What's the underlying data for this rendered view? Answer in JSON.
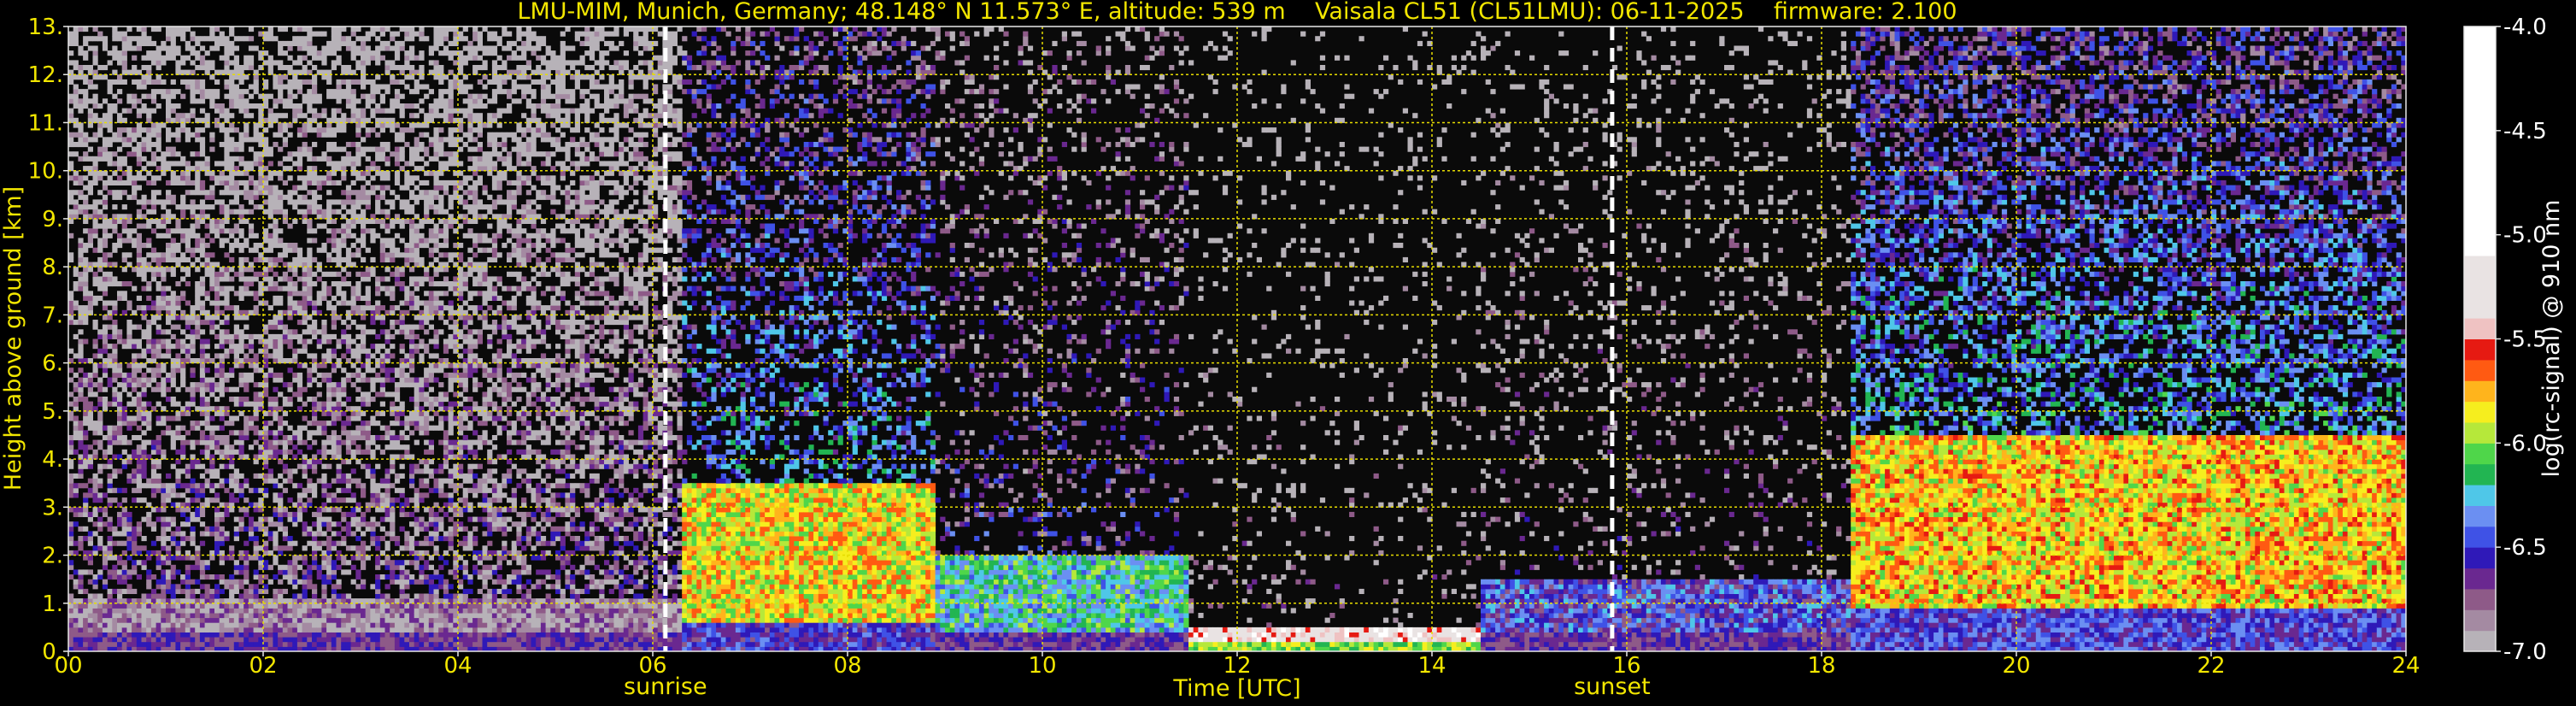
{
  "chart_data": {
    "type": "heatmap",
    "title": "LMU-MIM, Munich, Germany; 48.148° N 11.573° E, altitude: 539 m    Vaisala CL51 (CL51LMU): 06-11-2025    firmware: 2.100",
    "xlabel": "Time [UTC]",
    "ylabel": "Height above ground [km]",
    "colorbar_label": "log(rc-signal) @ 910 nm",
    "xlim": [
      0,
      24
    ],
    "ylim": [
      0,
      13
    ],
    "clim": [
      -7.0,
      -4.0
    ],
    "grid": true,
    "x_ticks": [
      {
        "value": 0,
        "label": "00"
      },
      {
        "value": 2,
        "label": "02"
      },
      {
        "value": 4,
        "label": "04"
      },
      {
        "value": 6,
        "label": "06"
      },
      {
        "value": 8,
        "label": "08"
      },
      {
        "value": 10,
        "label": "10"
      },
      {
        "value": 12,
        "label": "12"
      },
      {
        "value": 14,
        "label": "14"
      },
      {
        "value": 16,
        "label": "16"
      },
      {
        "value": 18,
        "label": "18"
      },
      {
        "value": 20,
        "label": "20"
      },
      {
        "value": 22,
        "label": "22"
      },
      {
        "value": 24,
        "label": "24"
      }
    ],
    "y_ticks": [
      {
        "value": 0,
        "label": "0."
      },
      {
        "value": 1,
        "label": "1."
      },
      {
        "value": 2,
        "label": "2."
      },
      {
        "value": 3,
        "label": "3."
      },
      {
        "value": 4,
        "label": "4."
      },
      {
        "value": 5,
        "label": "5."
      },
      {
        "value": 6,
        "label": "6."
      },
      {
        "value": 7,
        "label": "7."
      },
      {
        "value": 8,
        "label": "8."
      },
      {
        "value": 9,
        "label": "9."
      },
      {
        "value": 10,
        "label": "10."
      },
      {
        "value": 11,
        "label": "11."
      },
      {
        "value": 12,
        "label": "12."
      },
      {
        "value": 13,
        "label": "13."
      }
    ],
    "colorbar_ticks": [
      {
        "value": -4.0,
        "label": "-4.0"
      },
      {
        "value": -4.5,
        "label": "-4.5"
      },
      {
        "value": -5.0,
        "label": "-5.0"
      },
      {
        "value": -5.5,
        "label": "-5.5"
      },
      {
        "value": -6.0,
        "label": "-6.0"
      },
      {
        "value": -6.5,
        "label": "-6.5"
      },
      {
        "value": -7.0,
        "label": "-7.0"
      }
    ],
    "events": [
      {
        "label": "sunrise",
        "time": 6.13
      },
      {
        "label": "sunset",
        "time": 15.85
      }
    ],
    "colormap": [
      {
        "from": -7.0,
        "to": -6.9,
        "color": "#b7b2b8"
      },
      {
        "from": -6.9,
        "to": -6.8,
        "color": "#a48aa2"
      },
      {
        "from": -6.8,
        "to": -6.7,
        "color": "#8e5a88"
      },
      {
        "from": -6.7,
        "to": -6.6,
        "color": "#6a2890"
      },
      {
        "from": -6.6,
        "to": -6.5,
        "color": "#2f19b8"
      },
      {
        "from": -6.5,
        "to": -6.4,
        "color": "#3f52e6"
      },
      {
        "from": -6.4,
        "to": -6.3,
        "color": "#6b8ff2"
      },
      {
        "from": -6.3,
        "to": -6.2,
        "color": "#4fc7e8"
      },
      {
        "from": -6.2,
        "to": -6.1,
        "color": "#22b552"
      },
      {
        "from": -6.1,
        "to": -6.0,
        "color": "#4fd64a"
      },
      {
        "from": -6.0,
        "to": -5.9,
        "color": "#b6e83a"
      },
      {
        "from": -5.9,
        "to": -5.8,
        "color": "#f6ee1e"
      },
      {
        "from": -5.8,
        "to": -5.7,
        "color": "#ffb41c"
      },
      {
        "from": -5.7,
        "to": -5.6,
        "color": "#ff5a12"
      },
      {
        "from": -5.6,
        "to": -5.5,
        "color": "#e61a12"
      },
      {
        "from": -5.5,
        "to": -5.4,
        "color": "#efc2c2"
      },
      {
        "from": -5.4,
        "to": -5.1,
        "color": "#e9e3e3"
      },
      {
        "from": -5.1,
        "to": -4.0,
        "color": "#ffffff"
      }
    ],
    "regimes": [
      {
        "start": 0.0,
        "end": 6.3,
        "surface_top_km": 0.35,
        "layer_top_km": 1.0,
        "layer_level": -6.85,
        "signal_level": -6.75,
        "density": 0.55
      },
      {
        "start": 6.3,
        "end": 8.9,
        "surface_top_km": 0.6,
        "layer_top_km": 3.5,
        "layer_level": -5.85,
        "signal_level": -6.35,
        "density": 0.35
      },
      {
        "start": 8.9,
        "end": 11.5,
        "surface_top_km": 0.4,
        "layer_top_km": 2.0,
        "layer_level": -6.2,
        "signal_level": -6.6,
        "density": 0.18
      },
      {
        "start": 11.5,
        "end": 14.5,
        "surface_top_km": 0.15,
        "layer_top_km": 0.5,
        "layer_level": -5.3,
        "signal_level": -6.9,
        "density": 0.08
      },
      {
        "start": 14.5,
        "end": 18.3,
        "surface_top_km": 0.4,
        "layer_top_km": 1.5,
        "layer_level": -6.5,
        "signal_level": -6.8,
        "density": 0.12
      },
      {
        "start": 18.3,
        "end": 24.0,
        "surface_top_km": 0.8,
        "layer_top_km": 4.5,
        "layer_level": -5.8,
        "signal_level": -6.3,
        "density": 0.5
      }
    ]
  }
}
